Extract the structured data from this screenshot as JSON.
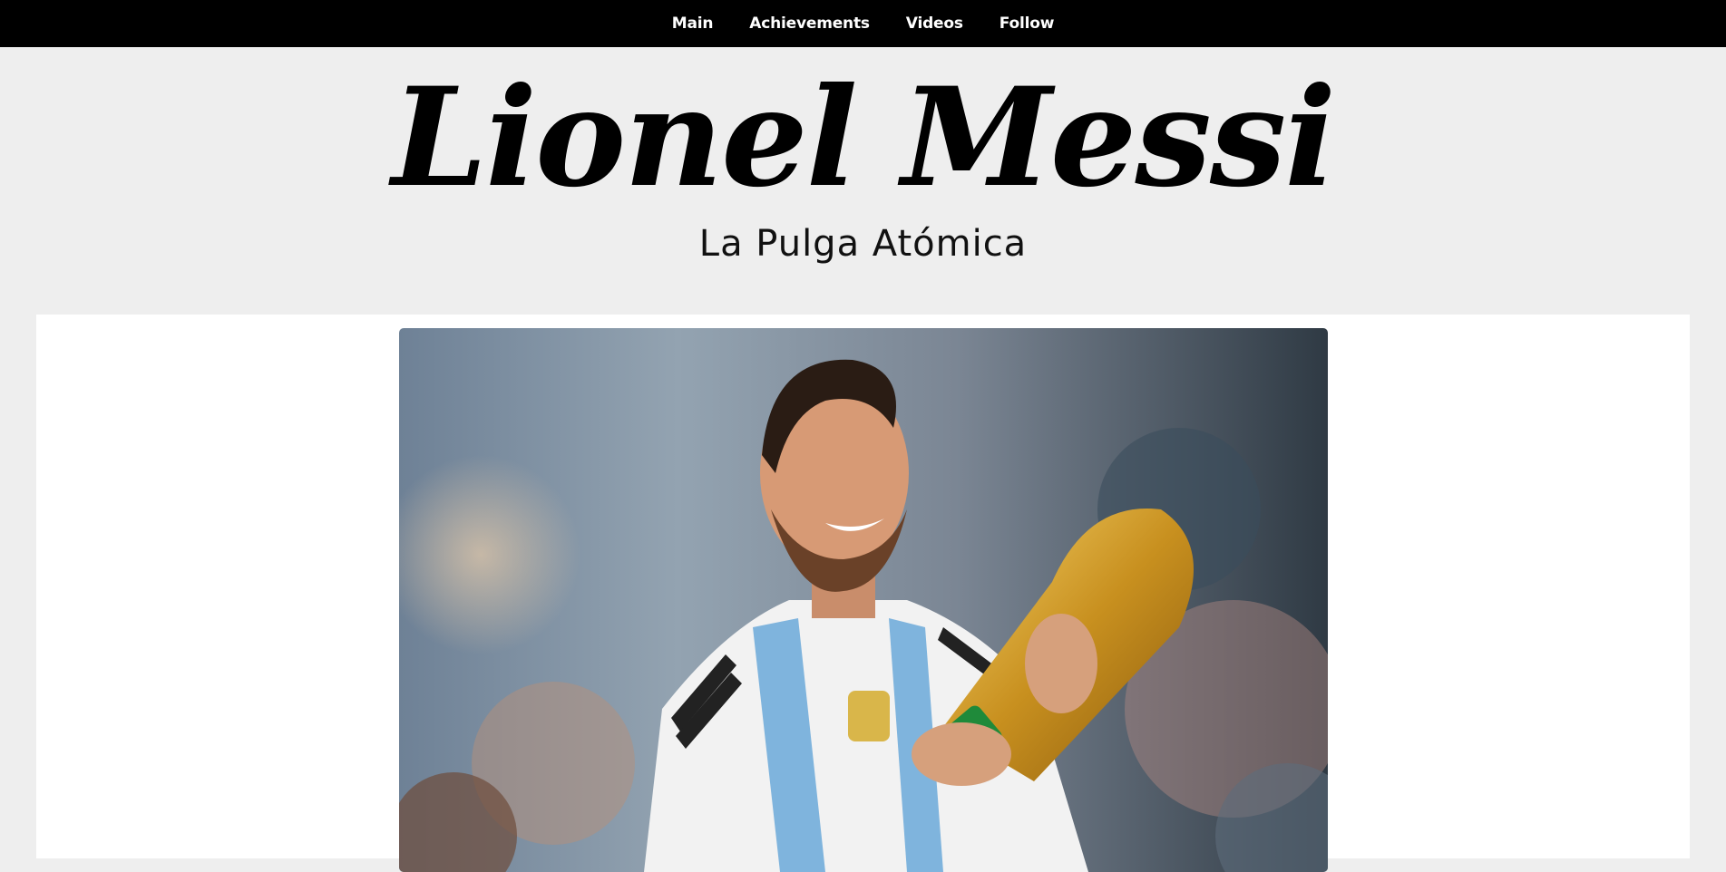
{
  "nav": {
    "items": [
      {
        "label": "Main"
      },
      {
        "label": "Achievements"
      },
      {
        "label": "Videos"
      },
      {
        "label": "Follow"
      }
    ]
  },
  "header": {
    "title": "Lionel Messi",
    "subtitle": "La Pulga Atómica"
  },
  "main": {
    "image": {
      "alt": "Lionel Messi holding the World Cup trophy"
    }
  },
  "colors": {
    "nav_bg": "#000000",
    "page_bg": "#eeeeee",
    "content_bg": "#ffffff"
  }
}
